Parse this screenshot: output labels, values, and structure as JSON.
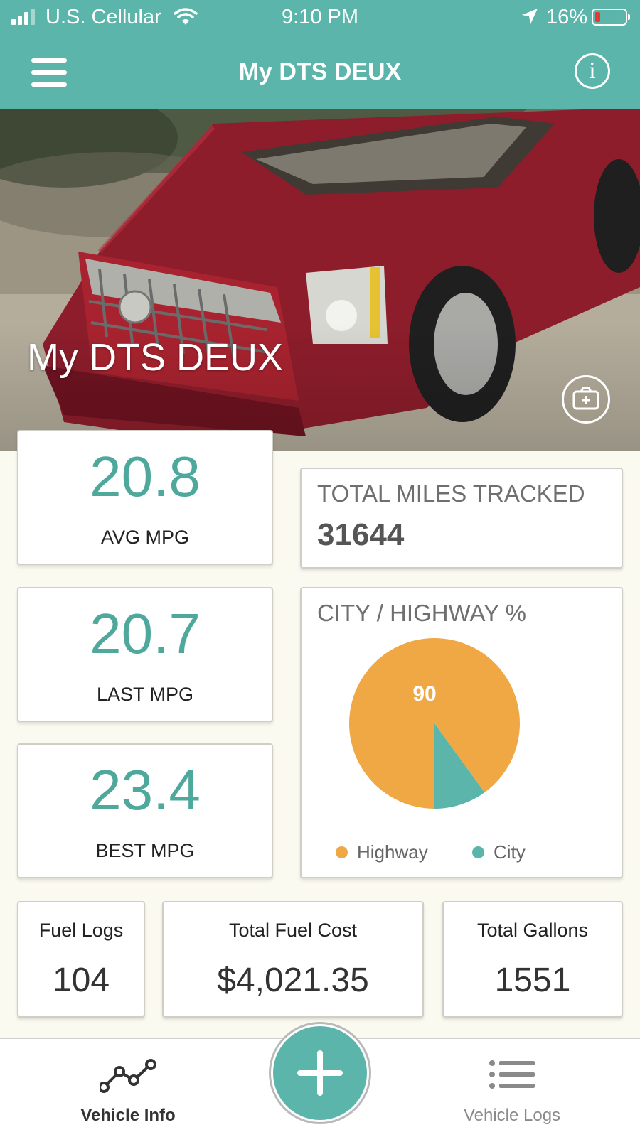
{
  "status_bar": {
    "carrier": "U.S. Cellular",
    "time": "9:10 PM",
    "battery": "16%"
  },
  "nav": {
    "title": "My DTS DEUX",
    "info_glyph": "i"
  },
  "hero": {
    "vehicle_name": "My DTS DEUX"
  },
  "stats": {
    "avg_mpg": {
      "value": "20.8",
      "label": "AVG MPG"
    },
    "last_mpg": {
      "value": "20.7",
      "label": "LAST MPG"
    },
    "best_mpg": {
      "value": "23.4",
      "label": "BEST MPG"
    },
    "total_miles": {
      "label": "TOTAL MILES TRACKED",
      "value": "31644"
    }
  },
  "chart_data": {
    "type": "pie",
    "title": "CITY / HIGHWAY %",
    "categories": [
      "Highway",
      "City"
    ],
    "values": [
      90,
      10
    ],
    "data_labels": [
      "90"
    ],
    "legend_placement": "bottom",
    "colors": {
      "Highway": "#f0a844",
      "City": "#5bb5aa"
    }
  },
  "summary": {
    "fuel_logs": {
      "label": "Fuel Logs",
      "value": "104"
    },
    "total_fuel_cost": {
      "label": "Total Fuel Cost",
      "value": "$4,021.35"
    },
    "total_gallons": {
      "label": "Total Gallons",
      "value": "1551"
    }
  },
  "tabs": {
    "vehicle_info": "Vehicle Info",
    "vehicle_logs": "Vehicle Logs"
  },
  "colors": {
    "accent": "#5bb5aa",
    "highway": "#f0a844",
    "background": "#fbfaf0"
  },
  "icons": [
    "signal-icon",
    "wifi-icon",
    "location-arrow-icon",
    "battery-icon",
    "hamburger-menu-icon",
    "info-icon",
    "camera-add-icon",
    "line-chart-icon",
    "plus-icon",
    "list-icon"
  ]
}
